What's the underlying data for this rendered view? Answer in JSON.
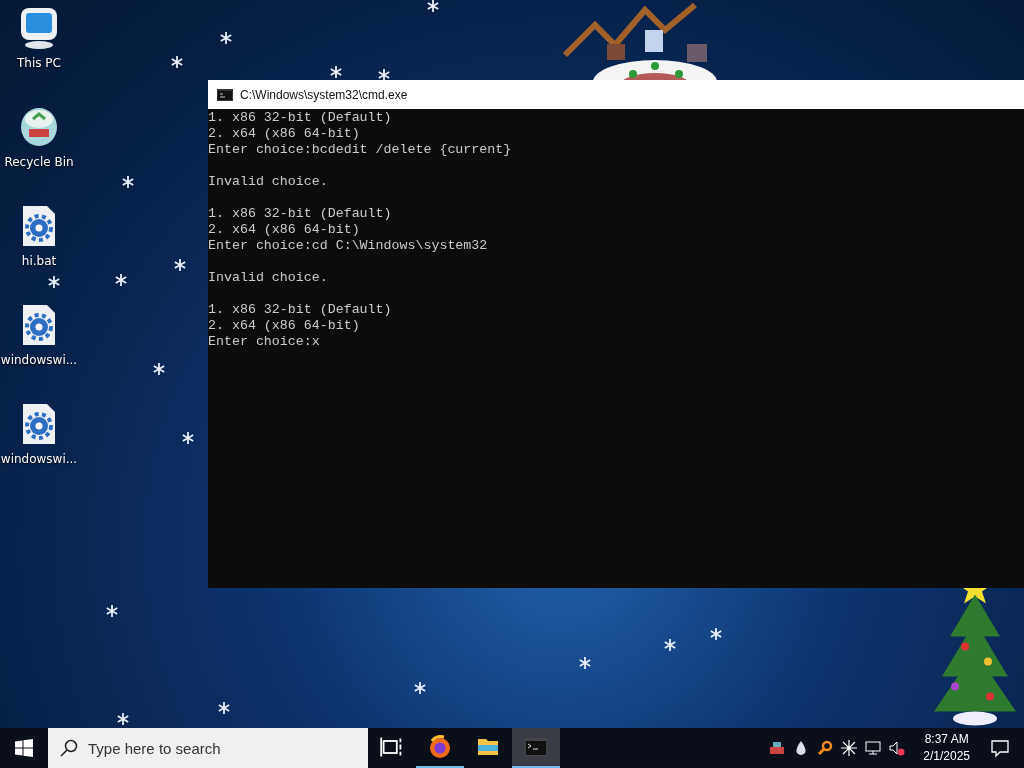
{
  "desktop_icons": [
    {
      "label": "This PC",
      "kind": "computer"
    },
    {
      "label": "Recycle Bin",
      "kind": "recycle"
    },
    {
      "label": "hi.bat",
      "kind": "file"
    },
    {
      "label": "windowswi...",
      "kind": "file"
    },
    {
      "label": "windowswi...",
      "kind": "file"
    }
  ],
  "window": {
    "title": "C:\\Windows\\system32\\cmd.exe",
    "output_blocks": [
      [
        "1. x86 32-bit (Default)",
        "2. x64 (x86 64-bit)",
        "Enter choice:bcdedit /delete {current}"
      ],
      [
        "Invalid choice."
      ],
      [
        "1. x86 32-bit (Default)",
        "2. x64 (x86 64-bit)",
        "Enter choice:cd C:\\Windows\\system32"
      ],
      [
        "Invalid choice."
      ],
      [
        "1. x86 32-bit (Default)",
        "2. x64 (x86 64-bit)",
        "Enter choice:x"
      ]
    ]
  },
  "taskbar": {
    "search": {
      "placeholder": "Type here to search"
    },
    "apps": [
      {
        "kind": "task-view",
        "running": false,
        "selected": false
      },
      {
        "kind": "browser",
        "running": true,
        "selected": false
      },
      {
        "kind": "folder",
        "running": false,
        "selected": false
      },
      {
        "kind": "terminal",
        "running": true,
        "selected": true
      }
    ],
    "clock": {
      "time": "8:37 AM",
      "date": "2/1/2025"
    }
  }
}
